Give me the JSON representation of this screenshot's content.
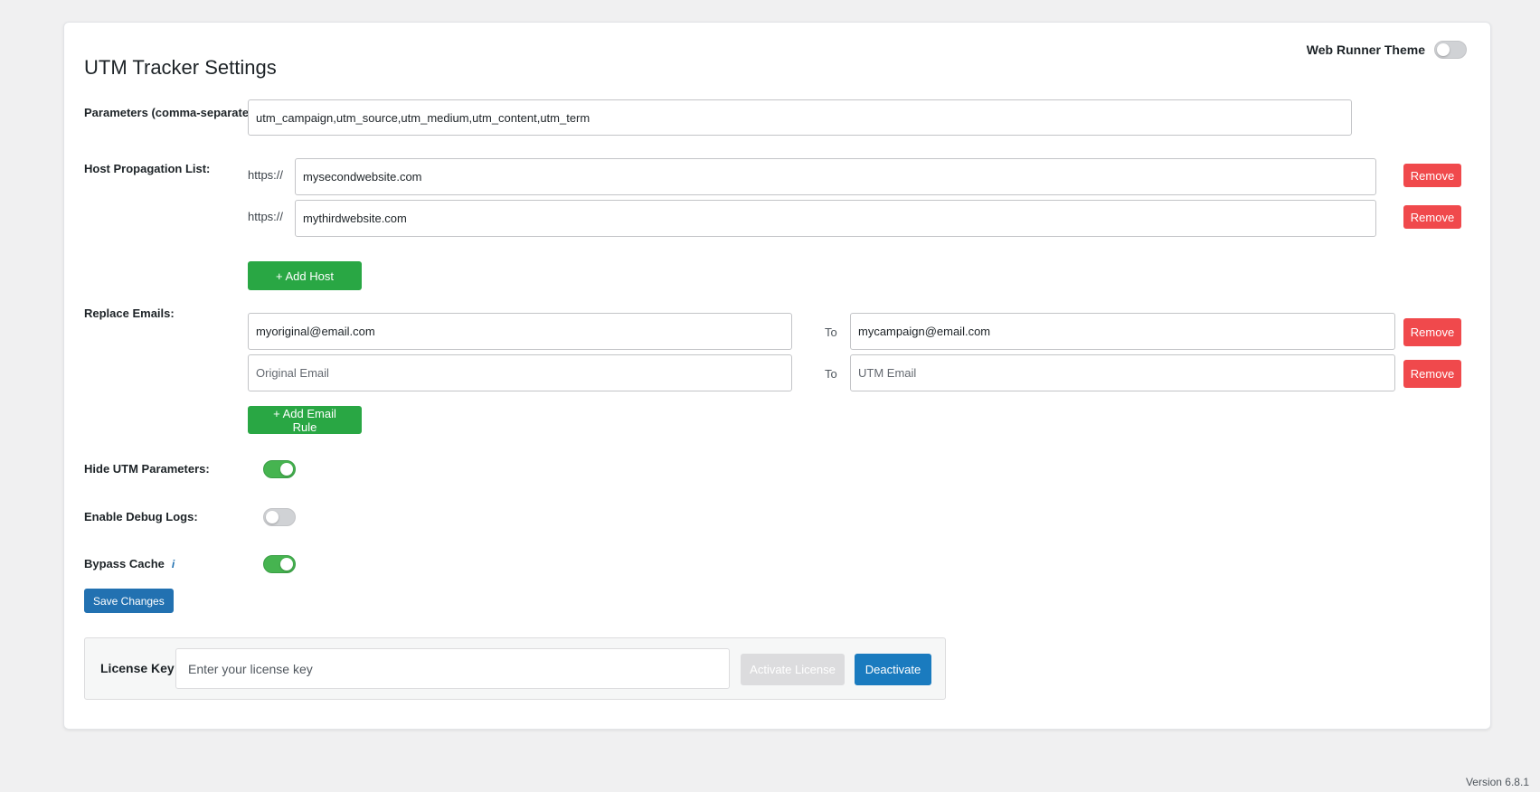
{
  "title": "UTM Tracker Settings",
  "theme_toggle": {
    "label": "Web Runner Theme",
    "enabled": false
  },
  "parameters": {
    "label": "Parameters (comma-separated)",
    "value": "utm_campaign,utm_source,utm_medium,utm_content,utm_term"
  },
  "hosts": {
    "label": "Host Propagation List:",
    "prefix": "https://",
    "items": [
      {
        "value": "mysecondwebsite.com",
        "remove_label": "Remove"
      },
      {
        "value": "mythirdwebsite.com",
        "remove_label": "Remove"
      }
    ],
    "add_label": "+ Add Host"
  },
  "emails": {
    "label": "Replace Emails:",
    "to_label": "To",
    "original_placeholder": "Original Email",
    "utm_placeholder": "UTM Email",
    "rules": [
      {
        "original": "myoriginal@email.com",
        "utm": "mycampaign@email.com",
        "remove_label": "Remove"
      },
      {
        "original": "",
        "utm": "",
        "remove_label": "Remove"
      }
    ],
    "add_label": "+ Add Email Rule"
  },
  "toggles": {
    "hide_utm": {
      "label": "Hide UTM Parameters:",
      "enabled": true
    },
    "debug_logs": {
      "label": "Enable Debug Logs:",
      "enabled": false
    },
    "bypass_cache": {
      "label": "Bypass Cache",
      "enabled": true
    }
  },
  "save_label": "Save Changes",
  "license": {
    "label": "License Key",
    "placeholder": "Enter your license key",
    "value": "",
    "activate_label": "Activate License",
    "deactivate_label": "Deactivate"
  },
  "version": "Version 6.8.1",
  "colors": {
    "green": "#29a744",
    "red": "#f0494c",
    "blue": "#2271b1",
    "toggle_on": "#46b450"
  },
  "icons": {
    "info": "info-icon"
  }
}
